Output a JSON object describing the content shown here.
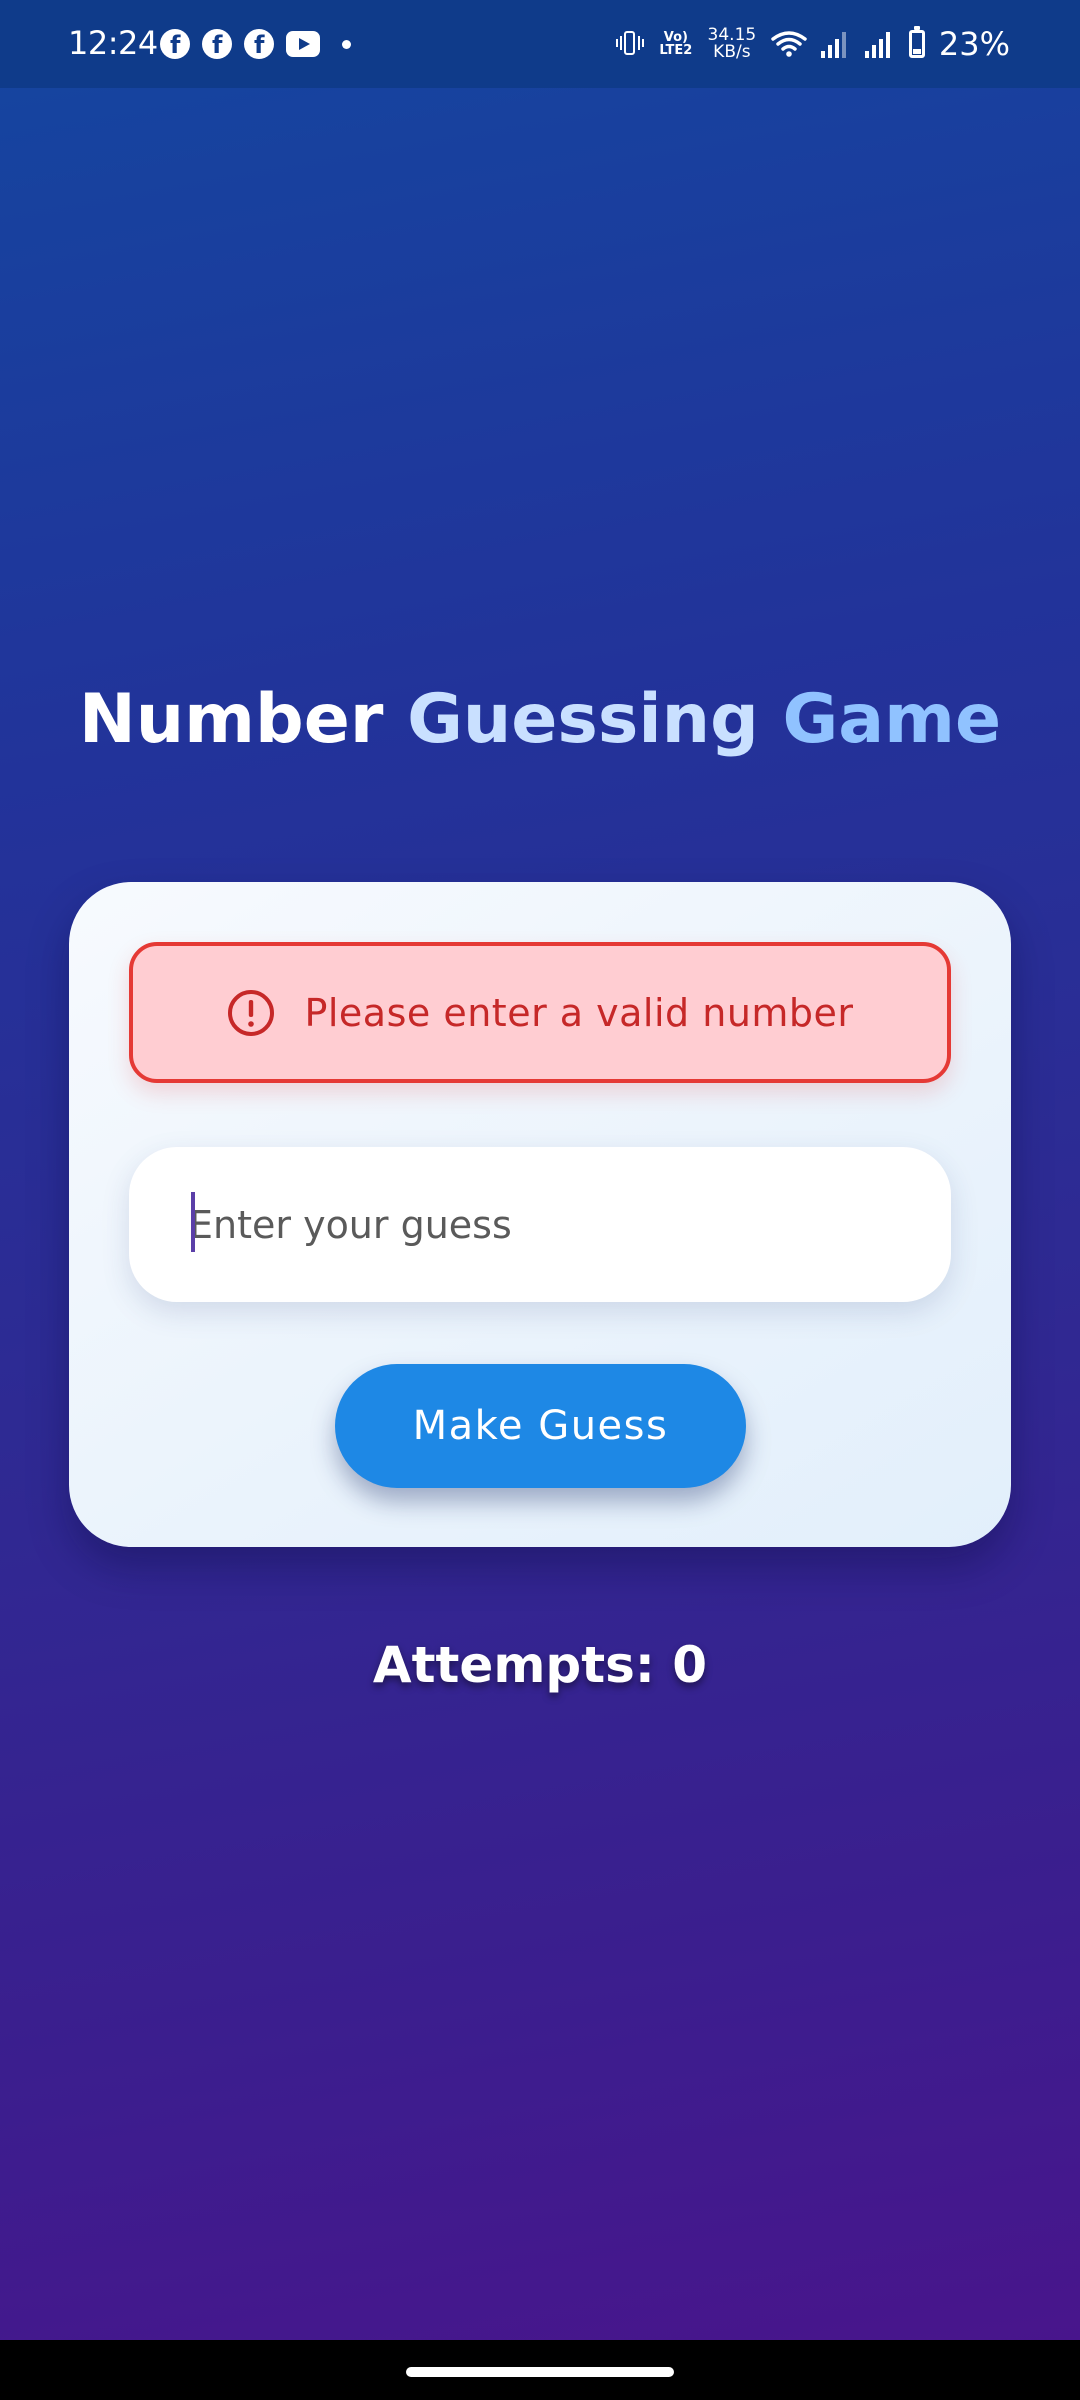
{
  "status_bar": {
    "time": "12:24",
    "notification_icons": [
      "facebook-icon",
      "facebook-icon",
      "facebook-icon",
      "youtube-icon",
      "dot-icon"
    ],
    "volte_line1": "Vo)",
    "volte_line2": "LTE2",
    "net_speed_value": "34.15",
    "net_speed_unit": "KB/s",
    "battery_percent": "23%",
    "battery_level": 0.23
  },
  "game": {
    "title_word1": "Number",
    "title_word2": "Guessing",
    "title_word3": "Game",
    "error_message": "Please enter a valid number",
    "input_placeholder": "Enter your guess",
    "input_value": "",
    "button_label": "Make Guess",
    "attempts_text": "Attempts: 0"
  },
  "colors": {
    "error_border": "#e53935",
    "error_background": "#ffcdd2",
    "error_text": "#c62828",
    "button": "#1e88e5",
    "title_accent_light": "#c9e0ff",
    "title_accent": "#90c2ff"
  }
}
